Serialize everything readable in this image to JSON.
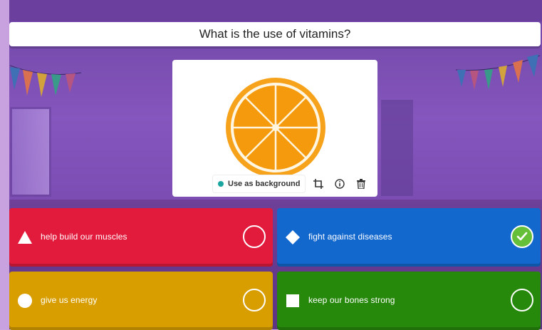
{
  "question": {
    "text": "What is the use of vitamins?"
  },
  "media": {
    "image_icon": "orange-slice",
    "use_as_background_label": "Use as background",
    "tools": [
      "crop-icon",
      "info-icon",
      "trash-icon"
    ]
  },
  "answers": [
    {
      "text": "help build our muscles",
      "shape": "triangle",
      "color": "#e21b3c",
      "correct": false
    },
    {
      "text": "fight against diseases",
      "shape": "diamond",
      "color": "#1368ce",
      "correct": true
    },
    {
      "text": "give us energy",
      "shape": "circle",
      "color": "#d89e00",
      "correct": false
    },
    {
      "text": "keep our bones strong",
      "shape": "square",
      "color": "#26890c",
      "correct": false
    }
  ],
  "colors": {
    "correct_check": "#66bf39",
    "accent_teal": "#1aa6a0"
  }
}
